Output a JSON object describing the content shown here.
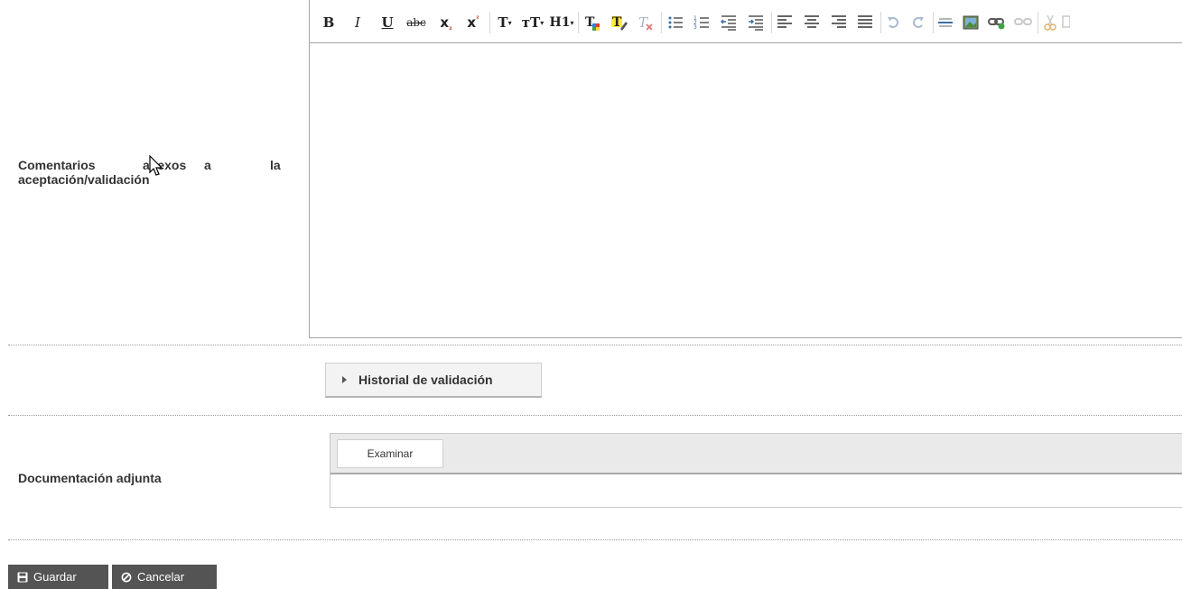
{
  "form": {
    "comments_label_words": [
      "Comentarios",
      "anexos",
      "a",
      "la"
    ],
    "comments_label_line2": "aceptación/validación",
    "history_label": "Historial de validación",
    "attachments_label": "Documentación adjunta",
    "browse_label": "Examinar"
  },
  "toolbar": {
    "bold": "B",
    "italic": "I",
    "underline": "U",
    "strike": "abc",
    "subscript": "x",
    "superscript": "x",
    "font": "T",
    "font_size": "тТ",
    "heading": "H1"
  },
  "actions": {
    "save_label": "Guardar",
    "cancel_label": "Cancelar"
  },
  "colors": {
    "button_bg": "#545454",
    "border": "#a5a5a5"
  }
}
